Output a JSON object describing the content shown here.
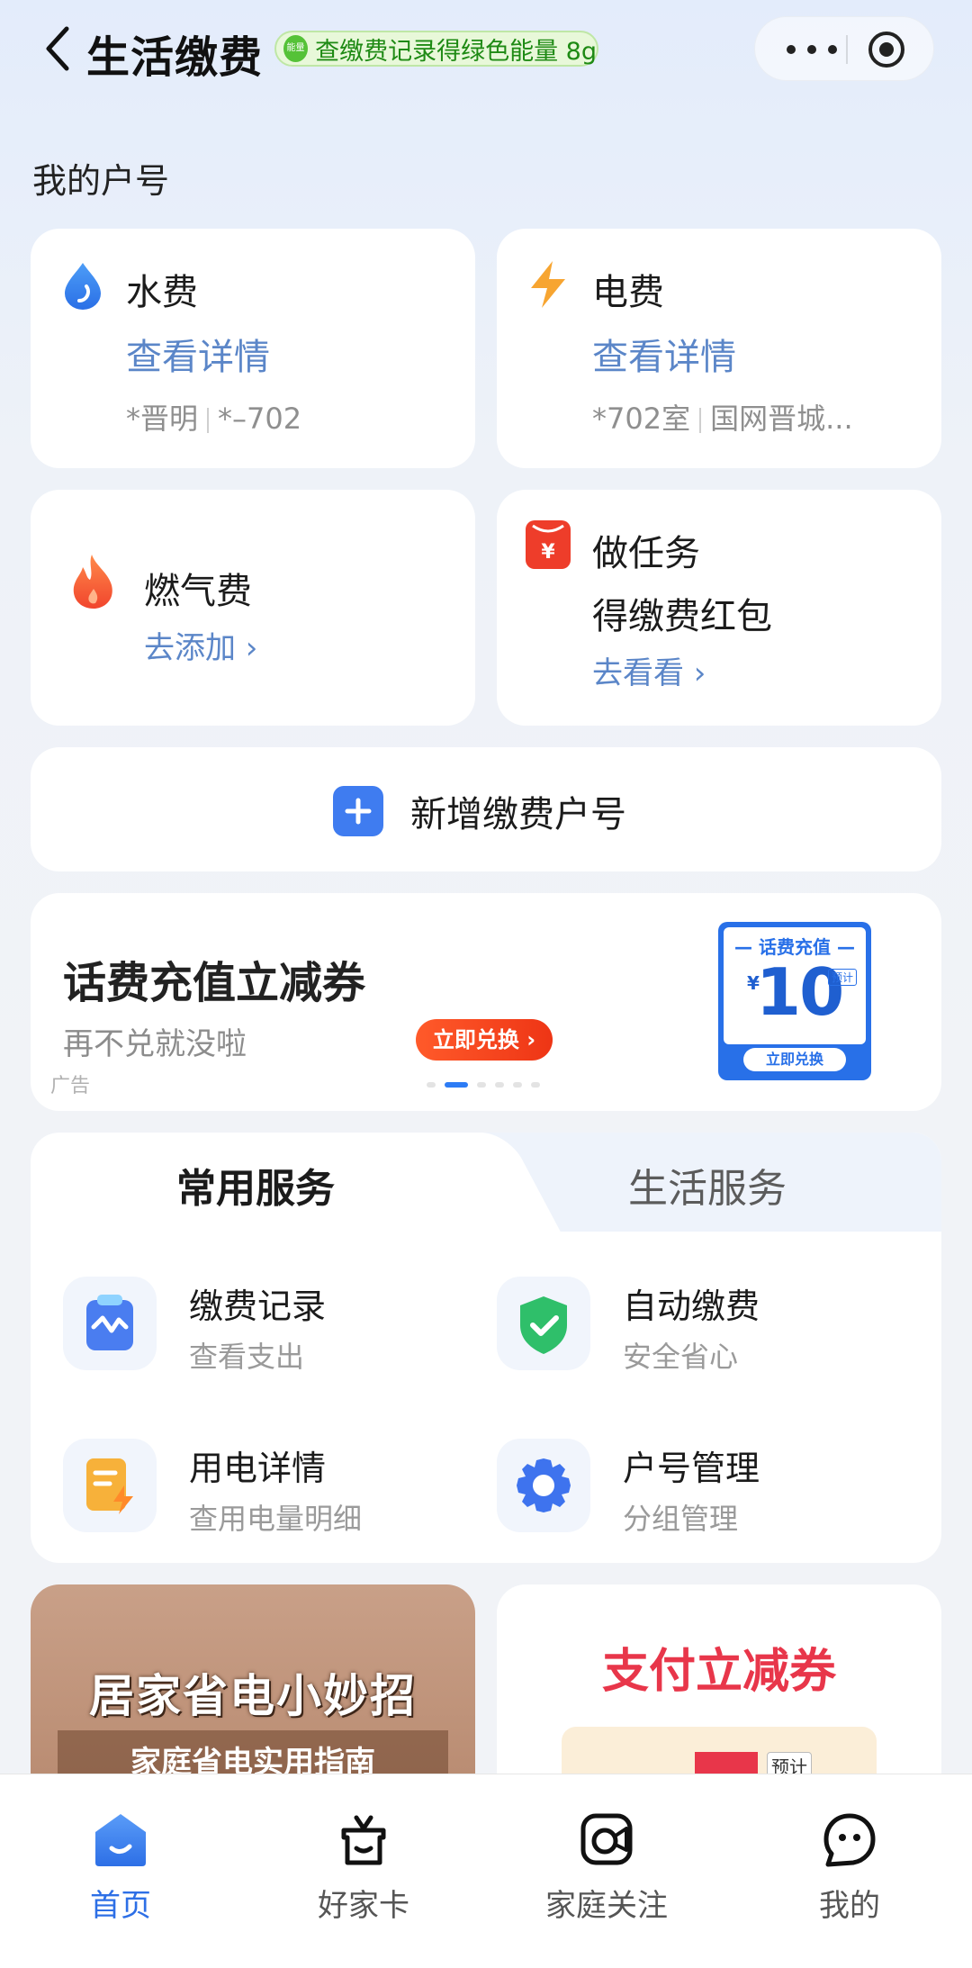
{
  "header": {
    "title": "生活缴费",
    "energy_badge": "能量",
    "energy_text": "查缴费记录得绿色能量 8g",
    "more_icon": "more-dots-icon",
    "close_icon": "target-circle-icon"
  },
  "accounts_section": {
    "title": "我的户号",
    "water": {
      "name": "水费",
      "link": "查看详情",
      "owner": "*晋明",
      "room": "*–702",
      "icon": "water-drop-icon"
    },
    "electric": {
      "name": "电费",
      "link": "查看详情",
      "room": "*702室",
      "company": "国网晋城...",
      "icon": "lightning-icon"
    },
    "gas": {
      "name": "燃气费",
      "link": "去添加 ›",
      "icon": "flame-icon"
    },
    "task": {
      "line1": "做任务",
      "line2": "得缴费红包",
      "link": "去看看 ›",
      "icon": "red-envelope-icon"
    },
    "add_account": "新增缴费户号"
  },
  "ad_banner": {
    "title": "话费充值立减券",
    "subtitle": "再不兑就没啦",
    "button": "立即兑换 ›",
    "tag": "广告",
    "coupon_head": "— 话费充值 —",
    "coupon_yen": "¥",
    "coupon_value": "10",
    "coupon_est": "预计",
    "coupon_button": "立即兑换",
    "active_dot": 1
  },
  "services": {
    "tabs": [
      "常用服务",
      "生活服务"
    ],
    "items": [
      {
        "title": "缴费记录",
        "sub": "查看支出",
        "icon": "clipboard-chart-icon"
      },
      {
        "title": "自动缴费",
        "sub": "安全省心",
        "icon": "shield-check-icon"
      },
      {
        "title": "用电详情",
        "sub": "查用电量明细",
        "icon": "bill-lightning-icon"
      },
      {
        "title": "户号管理",
        "sub": "分组管理",
        "icon": "gear-icon"
      }
    ]
  },
  "promos": {
    "left_title": "居家省电小妙招",
    "left_sub": "家庭省电实用指南",
    "right_title": "支付立减券",
    "right_tag": "预计"
  },
  "nav": {
    "items": [
      {
        "label": "首页",
        "icon": "home-icon",
        "active": true
      },
      {
        "label": "好家卡",
        "icon": "gift-box-icon",
        "active": false
      },
      {
        "label": "家庭关注",
        "icon": "camera-play-icon",
        "active": false
      },
      {
        "label": "我的",
        "icon": "profile-face-icon",
        "active": false
      }
    ]
  },
  "colors": {
    "accent_blue": "#2d6fe6",
    "link_blue": "#5b86c8",
    "energy_green": "#1e8a14",
    "alert_red": "#ee3d2a"
  }
}
